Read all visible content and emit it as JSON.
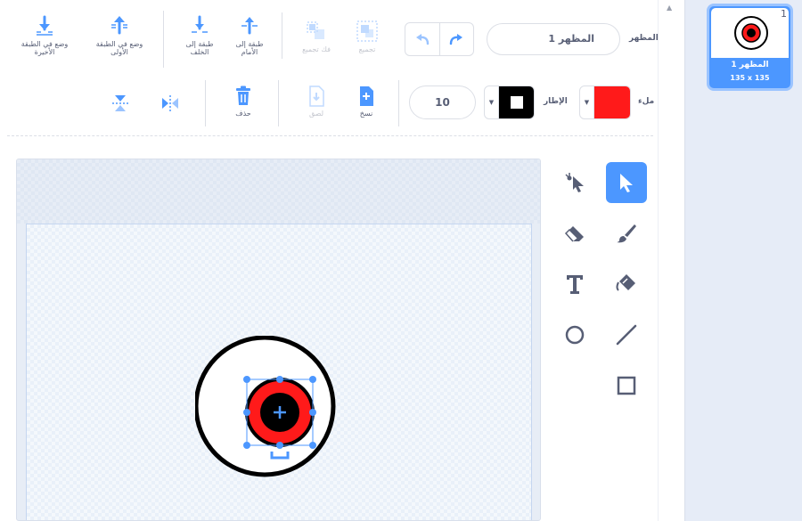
{
  "toolbar": {
    "layer_back_last": "وضع في الطبقة الأخيرة",
    "layer_front_first": "وضع في الطبقة الأولى",
    "layer_backward": "طبقة إلى الخلف",
    "layer_forward": "طبقة إلى الأمام",
    "ungroup": "فك تجميع",
    "group": "تجميع",
    "costume_label": "المظهر",
    "costume_name": "المظهر 1",
    "delete": "حذف",
    "paste": "لصق",
    "copy": "نسخ",
    "outline_label": "الإطار",
    "fill_label": "ملء",
    "outline_width": "10"
  },
  "colors": {
    "accent": "#4c97ff",
    "fill": "#ff1a1a",
    "outline": "#000000"
  },
  "tools": [
    {
      "name": "select",
      "icon": "arrow-cursor-icon",
      "active": true
    },
    {
      "name": "reshape",
      "icon": "reshape-cursor-icon",
      "active": false
    },
    {
      "name": "brush",
      "icon": "brush-icon",
      "active": false
    },
    {
      "name": "eraser",
      "icon": "eraser-icon",
      "active": false
    },
    {
      "name": "fill",
      "icon": "paint-bucket-icon",
      "active": false
    },
    {
      "name": "text",
      "icon": "text-icon",
      "active": false
    },
    {
      "name": "line",
      "icon": "line-icon",
      "active": false
    },
    {
      "name": "circle",
      "icon": "circle-icon",
      "active": false
    },
    {
      "name": "rectangle",
      "icon": "rectangle-icon",
      "active": false
    }
  ],
  "costumes": [
    {
      "index": "1",
      "name": "المظهر 1",
      "size": "135 x 135",
      "selected": true
    }
  ]
}
